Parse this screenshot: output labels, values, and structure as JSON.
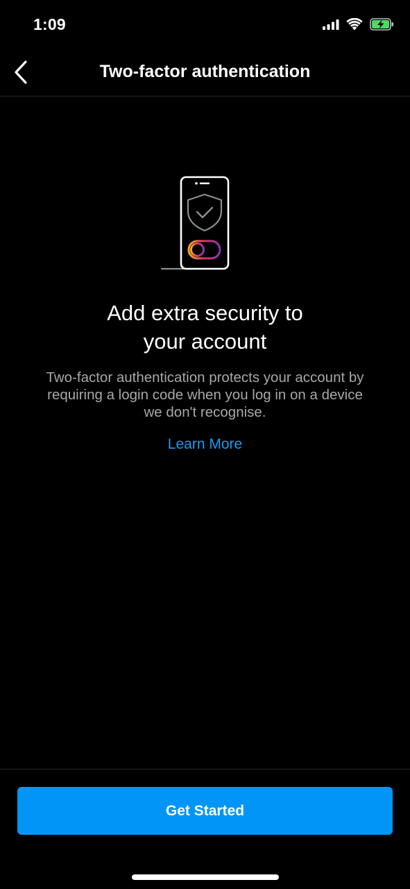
{
  "status_bar": {
    "time": "1:09"
  },
  "nav": {
    "back_icon": "chevron-left-icon",
    "title": "Two-factor authentication"
  },
  "illustration": {
    "icon": "phone-shield-check-icon",
    "toggle_gradient": [
      "#f9a825",
      "#e1306c",
      "#833ab4"
    ]
  },
  "content": {
    "headline_line1": "Add extra security to",
    "headline_line2": "your account",
    "description_line1": "Two-factor authentication protects your account by",
    "description_line2": "requiring a login code when you log in on a device",
    "description_line3": "we don't recognise.",
    "learn_more": "Learn More"
  },
  "footer": {
    "button_label": "Get Started"
  },
  "colors": {
    "background": "#000000",
    "accent": "#0095f6",
    "link": "#1a9bf0",
    "secondary_text": "#a8a8a8",
    "divider": "#262626",
    "battery_fill": "#4cd964"
  }
}
